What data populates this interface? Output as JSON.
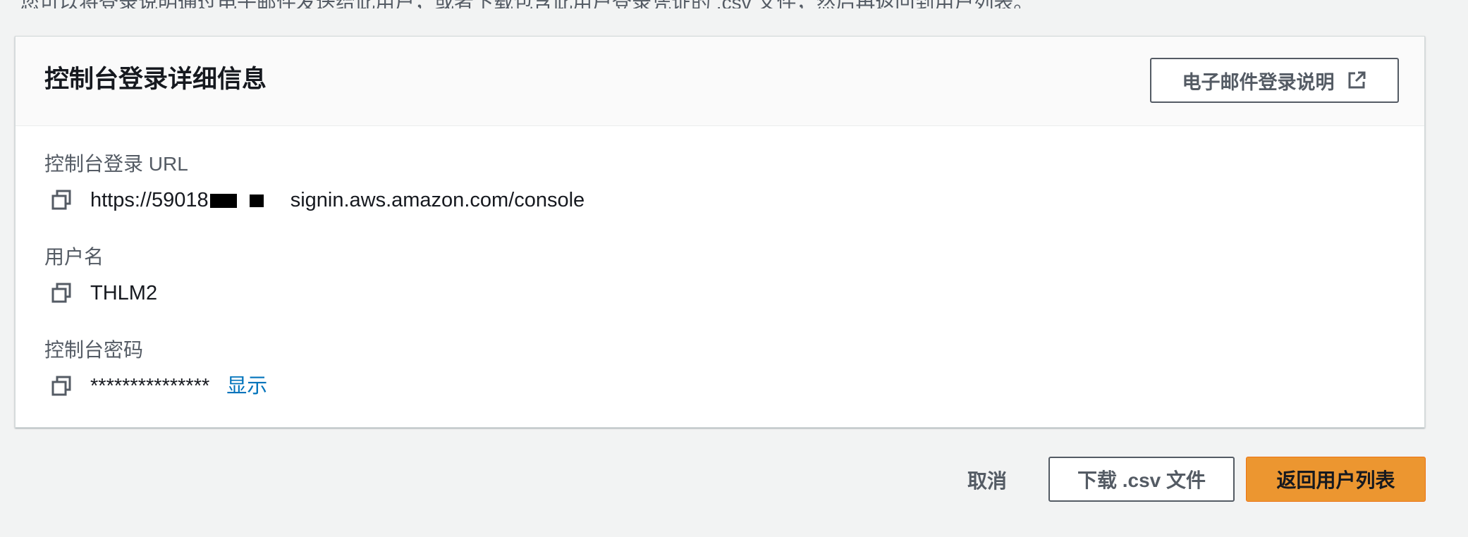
{
  "top_text": "您可以将登录说明通过电子邮件发送给此用户，或者下载包含此用户登录凭证的 .csv 文件，然后再返回到用户列表。",
  "panel": {
    "title": "控制台登录详细信息",
    "email_button_label": "电子邮件登录说明",
    "email_button_icon": "external-link-icon"
  },
  "fields": {
    "url": {
      "label": "控制台登录 URL",
      "value_prefix": "https://59018",
      "value_suffix": "signin.aws.amazon.com/console"
    },
    "username": {
      "label": "用户名",
      "value": "THLM2"
    },
    "password": {
      "label": "控制台密码",
      "value": "***************",
      "show_label": "显示"
    }
  },
  "footer": {
    "cancel_label": "取消",
    "download_label": "下载 .csv 文件",
    "return_label": "返回用户列表"
  },
  "colors": {
    "page_background": "#f2f3f3",
    "link": "#0073bb",
    "primary_button": "#ec9630",
    "secondary_text": "#545b64"
  }
}
